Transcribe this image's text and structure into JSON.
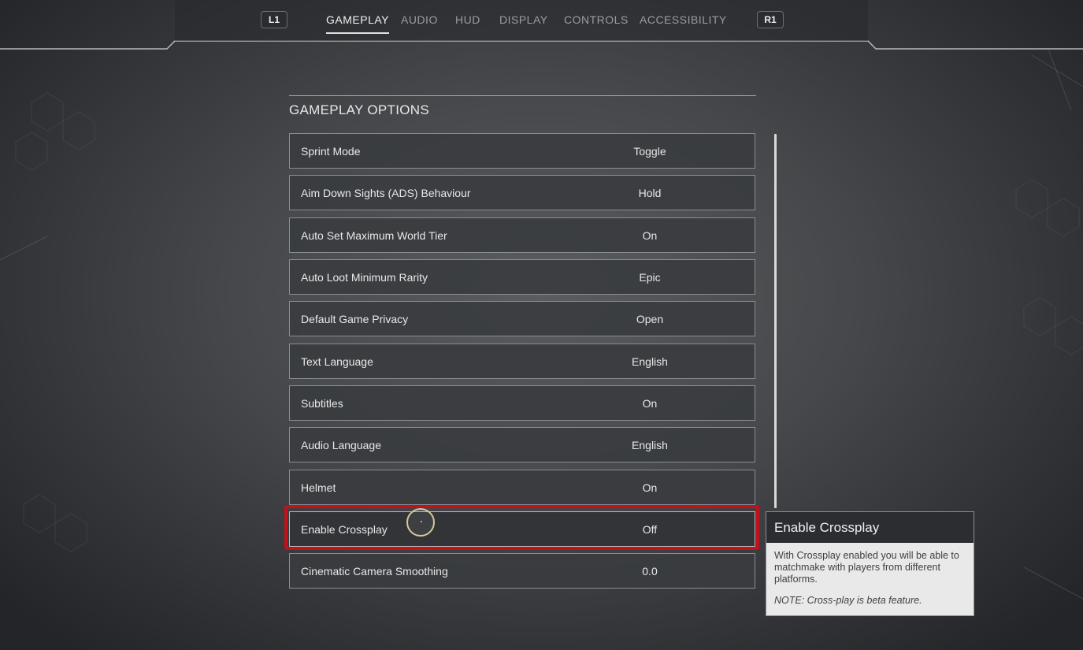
{
  "nav": {
    "left_button": "L1",
    "right_button": "R1",
    "tabs": [
      {
        "label": "GAMEPLAY",
        "active": true
      },
      {
        "label": "AUDIO",
        "active": false
      },
      {
        "label": "HUD",
        "active": false
      },
      {
        "label": "DISPLAY",
        "active": false
      },
      {
        "label": "CONTROLS",
        "active": false
      },
      {
        "label": "ACCESSIBILITY",
        "active": false
      }
    ]
  },
  "section": {
    "title": "GAMEPLAY OPTIONS"
  },
  "options": [
    {
      "label": "Sprint Mode",
      "value": "Toggle"
    },
    {
      "label": "Aim Down Sights (ADS) Behaviour",
      "value": "Hold"
    },
    {
      "label": "Auto Set Maximum World Tier",
      "value": "On"
    },
    {
      "label": "Auto Loot Minimum Rarity",
      "value": "Epic"
    },
    {
      "label": "Default Game Privacy",
      "value": "Open"
    },
    {
      "label": "Text Language",
      "value": "English"
    },
    {
      "label": "Subtitles",
      "value": "On"
    },
    {
      "label": "Audio Language",
      "value": "English"
    },
    {
      "label": "Helmet",
      "value": "On"
    },
    {
      "label": "Enable Crossplay",
      "value": "Off",
      "selected": true
    },
    {
      "label": "Cinematic Camera Smoothing",
      "value": "0.0"
    }
  ],
  "tooltip": {
    "title": "Enable Crossplay",
    "description": "With Crossplay enabled you will be able to matchmake with players from different platforms.",
    "note": "NOTE: Cross-play is beta feature."
  },
  "colors": {
    "highlight": "#c0121b",
    "background": "#45474a",
    "row_background": "#3a3c3f",
    "tooltip_header": "#2b2d30",
    "tooltip_body": "#e9e9e9"
  }
}
